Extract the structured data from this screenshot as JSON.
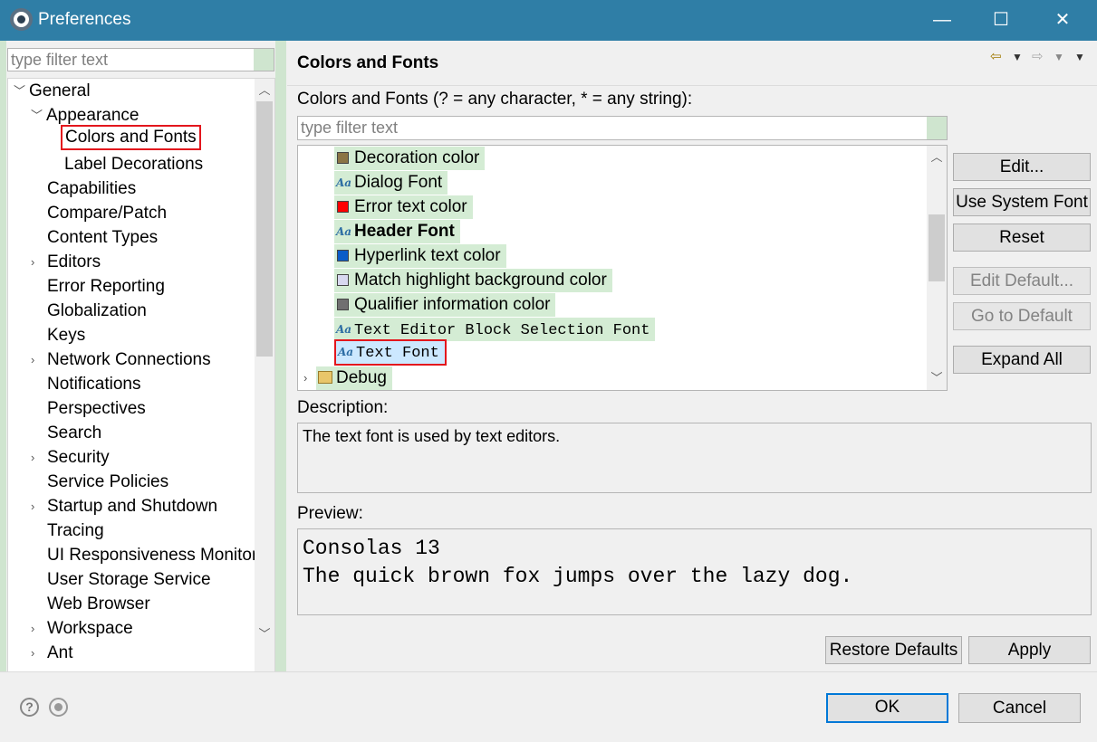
{
  "window": {
    "title": "Preferences",
    "minimize": "—",
    "maximize": "☐",
    "close": "✕"
  },
  "left": {
    "filter_placeholder": "type filter text",
    "tree": [
      {
        "label": "General",
        "twisty": "expanded"
      },
      {
        "label": "Appearance",
        "twisty": "expanded"
      },
      {
        "label": "Colors and Fonts",
        "twisty": "none",
        "selected": true
      },
      {
        "label": "Label Decorations",
        "twisty": "none"
      },
      {
        "label": "Capabilities",
        "twisty": "none"
      },
      {
        "label": "Compare/Patch",
        "twisty": "none"
      },
      {
        "label": "Content Types",
        "twisty": "none"
      },
      {
        "label": "Editors",
        "twisty": "collapsed"
      },
      {
        "label": "Error Reporting",
        "twisty": "none"
      },
      {
        "label": "Globalization",
        "twisty": "none"
      },
      {
        "label": "Keys",
        "twisty": "none"
      },
      {
        "label": "Network Connections",
        "twisty": "collapsed"
      },
      {
        "label": "Notifications",
        "twisty": "none"
      },
      {
        "label": "Perspectives",
        "twisty": "none"
      },
      {
        "label": "Search",
        "twisty": "none"
      },
      {
        "label": "Security",
        "twisty": "collapsed"
      },
      {
        "label": "Service Policies",
        "twisty": "none"
      },
      {
        "label": "Startup and Shutdown",
        "twisty": "collapsed"
      },
      {
        "label": "Tracing",
        "twisty": "none"
      },
      {
        "label": "UI Responsiveness Monitoring",
        "twisty": "none"
      },
      {
        "label": "User Storage Service",
        "twisty": "none"
      },
      {
        "label": "Web Browser",
        "twisty": "none"
      },
      {
        "label": "Workspace",
        "twisty": "collapsed"
      },
      {
        "label": "Ant",
        "twisty": "collapsed"
      }
    ]
  },
  "page": {
    "title": "Colors and Fonts",
    "instruction": "Colors and Fonts (? = any character, * = any string):",
    "filter_placeholder": "type filter text",
    "items": [
      {
        "label": "Decoration color",
        "kind": "color",
        "color": "#8b7545"
      },
      {
        "label": "Dialog Font",
        "kind": "font"
      },
      {
        "label": "Error text color",
        "kind": "color",
        "color": "#ff0000"
      },
      {
        "label": "Header Font",
        "kind": "font",
        "bold": true
      },
      {
        "label": "Hyperlink text color",
        "kind": "color",
        "color": "#0a5cc8"
      },
      {
        "label": "Match highlight background color",
        "kind": "color",
        "color": "#d8d8f0"
      },
      {
        "label": "Qualifier information color",
        "kind": "color",
        "color": "#707070"
      },
      {
        "label": "Text Editor Block Selection Font",
        "kind": "font",
        "mono": true
      },
      {
        "label": "Text Font",
        "kind": "font",
        "mono": true,
        "selected": true
      }
    ],
    "debug_label": "Debug",
    "buttons": {
      "edit": "Edit...",
      "use_system_font": "Use System Font",
      "reset": "Reset",
      "edit_default": "Edit Default...",
      "go_to_default": "Go to Default",
      "expand_all": "Expand All"
    },
    "description_label": "Description:",
    "description_text": "The text font is used by text editors.",
    "preview_label": "Preview:",
    "preview_line1": "Consolas 13",
    "preview_line2": "The quick brown fox jumps over the lazy dog.",
    "restore_defaults": "Restore Defaults",
    "apply": "Apply"
  },
  "footer": {
    "ok": "OK",
    "cancel": "Cancel",
    "help_glyph": "?"
  },
  "colors": {
    "titlebar": "#2f7ea6",
    "filter_match_highlight": "#d4ecd4",
    "selection_border": "#e3161d"
  }
}
